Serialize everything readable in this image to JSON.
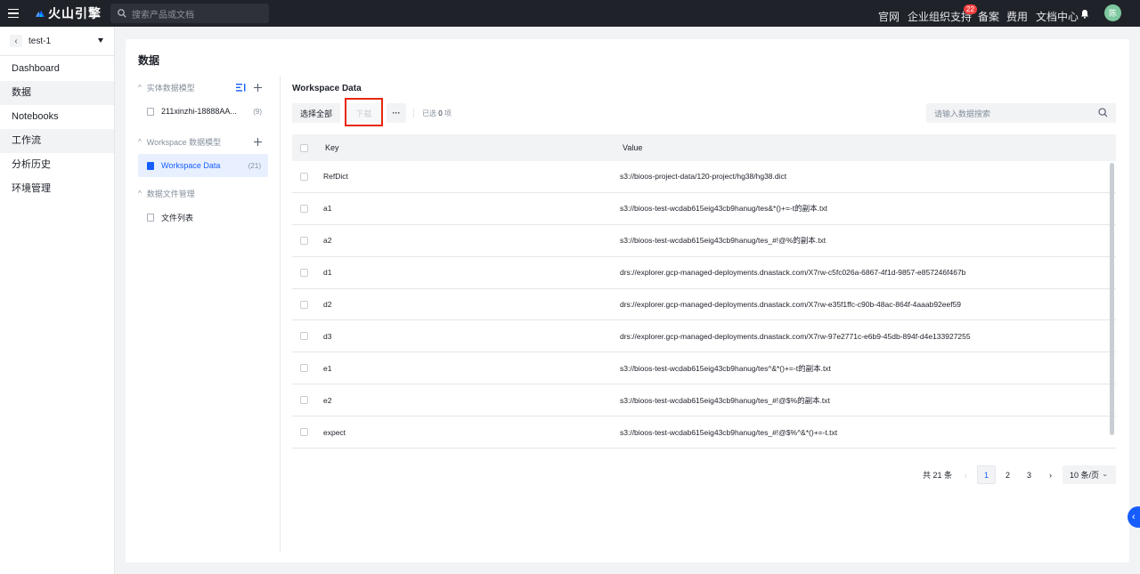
{
  "topbar": {
    "brand": "火山引擎",
    "search_placeholder": "搜索产品或文档",
    "nav": [
      "官网",
      "企业组织",
      "支持",
      "备案",
      "费用",
      "文档中心"
    ],
    "support_badge": "22",
    "avatar": "陈"
  },
  "sidebar": {
    "project": "test-1",
    "items": [
      "Dashboard",
      "数据",
      "Notebooks",
      "工作流",
      "分析历史",
      "环境管理"
    ]
  },
  "panel": {
    "title": "数据",
    "tree": {
      "entity_section": "实体数据模型",
      "entity_item": "211xinzhi-18888AA...",
      "entity_count": "(9)",
      "workspace_section": "Workspace 数据模型",
      "workspace_item": "Workspace Data",
      "workspace_count": "(21)",
      "file_section": "数据文件管理",
      "file_item": "文件列表"
    }
  },
  "content": {
    "title": "Workspace Data",
    "select_all": "选择全部",
    "download": "下载",
    "more": "···",
    "selected_prefix": "已选",
    "selected_count": "0",
    "selected_suffix": "项",
    "search_placeholder": "请输入数据搜索",
    "columns": [
      "Key",
      "Value"
    ],
    "rows": [
      {
        "key": "RefDict",
        "value": "s3://bioos-project-data/120-project/hg38/hg38.dict"
      },
      {
        "key": "a1",
        "value": "s3://bioos-test-wcdab615eig43cb9hanug/tes&*()+=-t的副本.txt"
      },
      {
        "key": "a2",
        "value": "s3://bioos-test-wcdab615eig43cb9hanug/tes_#!@%的副本.txt"
      },
      {
        "key": "d1",
        "value": "drs://explorer.gcp-managed-deployments.dnastack.com/X7rw-c5fc026a-6867-4f1d-9857-e857246f467b"
      },
      {
        "key": "d2",
        "value": "drs://explorer.gcp-managed-deployments.dnastack.com/X7rw-e35f1ffc-c90b-48ac-864f-4aaab92eef59"
      },
      {
        "key": "d3",
        "value": "drs://explorer.gcp-managed-deployments.dnastack.com/X7rw-97e2771c-e6b9-45db-894f-d4e133927255"
      },
      {
        "key": "e1",
        "value": "s3://bioos-test-wcdab615eig43cb9hanug/tes^&*()+=-t的副本.txt"
      },
      {
        "key": "e2",
        "value": "s3://bioos-test-wcdab615eig43cb9hanug/tes_#!@$%的副本.txt"
      },
      {
        "key": "expect",
        "value": "s3://bioos-test-wcdab615eig43cb9hanug/tes_#!@$%^&*()+=-t.txt"
      }
    ],
    "pagination": {
      "total": "共 21 条",
      "pages": [
        "1",
        "2",
        "3"
      ],
      "page_size": "10 条/页"
    }
  }
}
